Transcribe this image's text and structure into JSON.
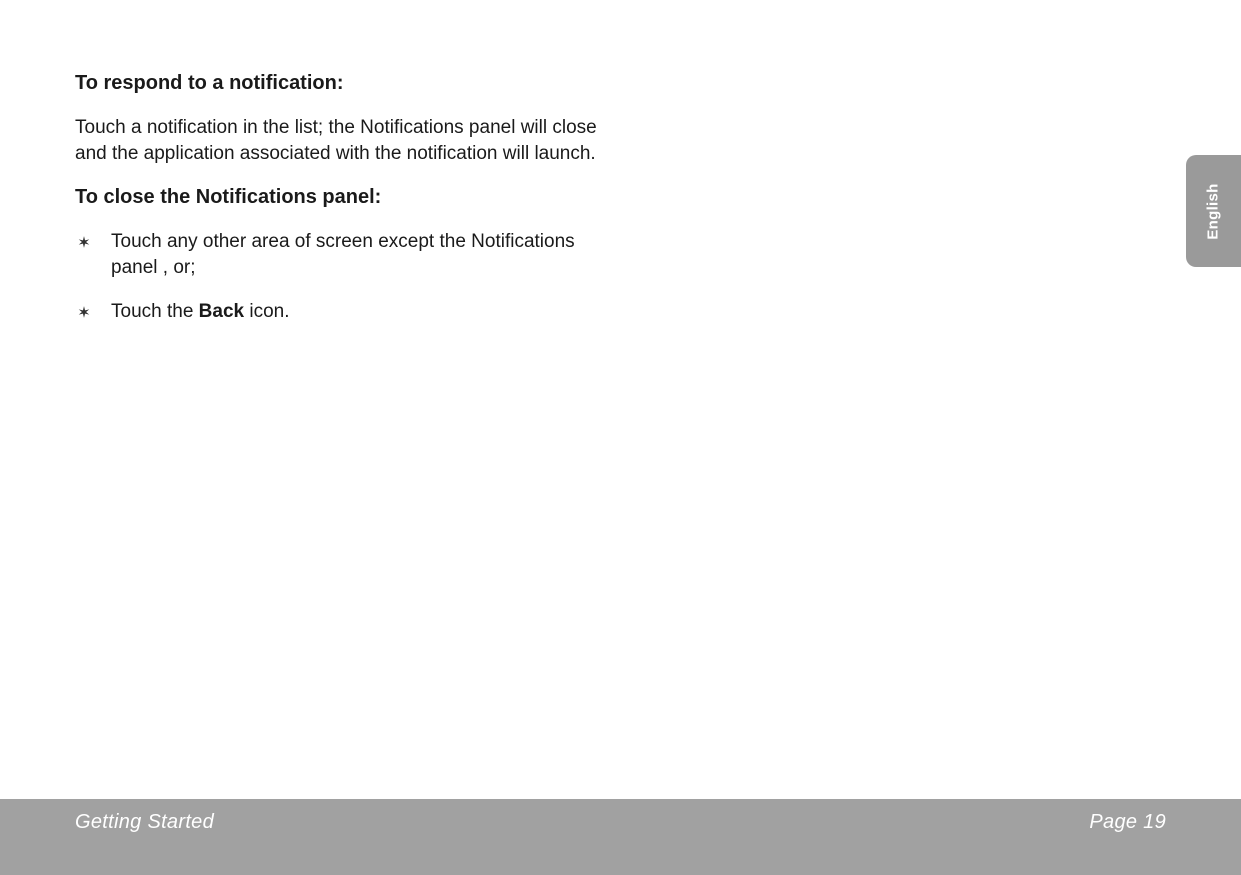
{
  "content": {
    "heading1": "To respond to a notification:",
    "paragraph1": "Touch a notification in the list; the Notifications panel will close and the application associated with the notification will launch.",
    "heading2": "To close the Notifications panel:",
    "list": [
      {
        "text": "Touch any other area of screen except the Notifications panel , or;"
      },
      {
        "prefix": "Touch the ",
        "bold": "Back",
        "suffix": " icon."
      }
    ]
  },
  "sideTab": {
    "label": "English"
  },
  "footer": {
    "section": "Getting Started",
    "page": "Page 19"
  }
}
